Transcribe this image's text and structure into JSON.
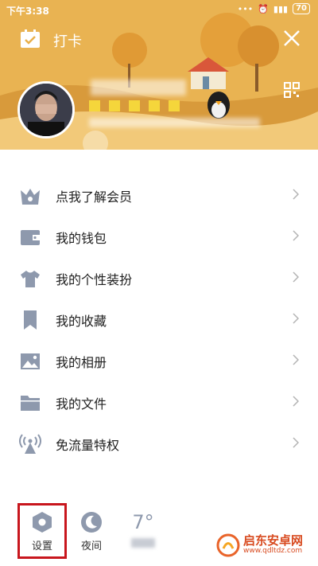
{
  "status_bar": {
    "time": "下午3:38",
    "battery": "70"
  },
  "header": {
    "checkin_label": "打卡"
  },
  "menu": [
    {
      "label": "点我了解会员",
      "icon": "crown-icon"
    },
    {
      "label": "我的钱包",
      "icon": "wallet-icon"
    },
    {
      "label": "我的个性装扮",
      "icon": "tshirt-icon"
    },
    {
      "label": "我的收藏",
      "icon": "bookmark-icon"
    },
    {
      "label": "我的相册",
      "icon": "image-icon"
    },
    {
      "label": "我的文件",
      "icon": "folder-icon"
    },
    {
      "label": "免流量特权",
      "icon": "signal-tower-icon"
    }
  ],
  "bottom": {
    "settings_label": "设置",
    "night_label": "夜间",
    "weather_temp": "7°"
  },
  "watermark": {
    "title": "启东安卓网",
    "url": "www.qdltdz.com"
  },
  "colors": {
    "accent_red": "#c8161d",
    "icon_gray": "#8e99ad",
    "banner": "#e9b04a"
  }
}
